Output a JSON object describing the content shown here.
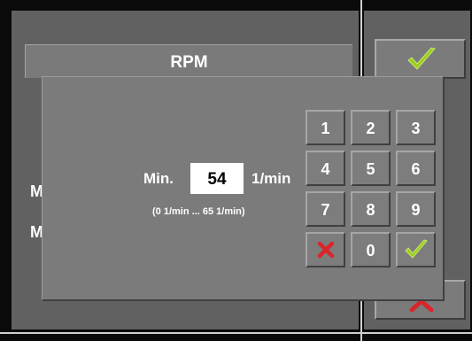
{
  "background": {
    "title": "RPM",
    "row_label_1": "M",
    "row_label_2": "M"
  },
  "dialog": {
    "field_label": "Min.",
    "value": "54",
    "unit": "1/min",
    "range_text": "(0 1/min ... 65 1/min)"
  },
  "keypad": {
    "keys": [
      "1",
      "2",
      "3",
      "4",
      "5",
      "6",
      "7",
      "8",
      "9",
      "0"
    ],
    "cancel_icon": "x-icon",
    "confirm_icon": "checkmark-icon"
  },
  "colors": {
    "confirm": "#9acd1f",
    "cancel": "#d8262b"
  }
}
